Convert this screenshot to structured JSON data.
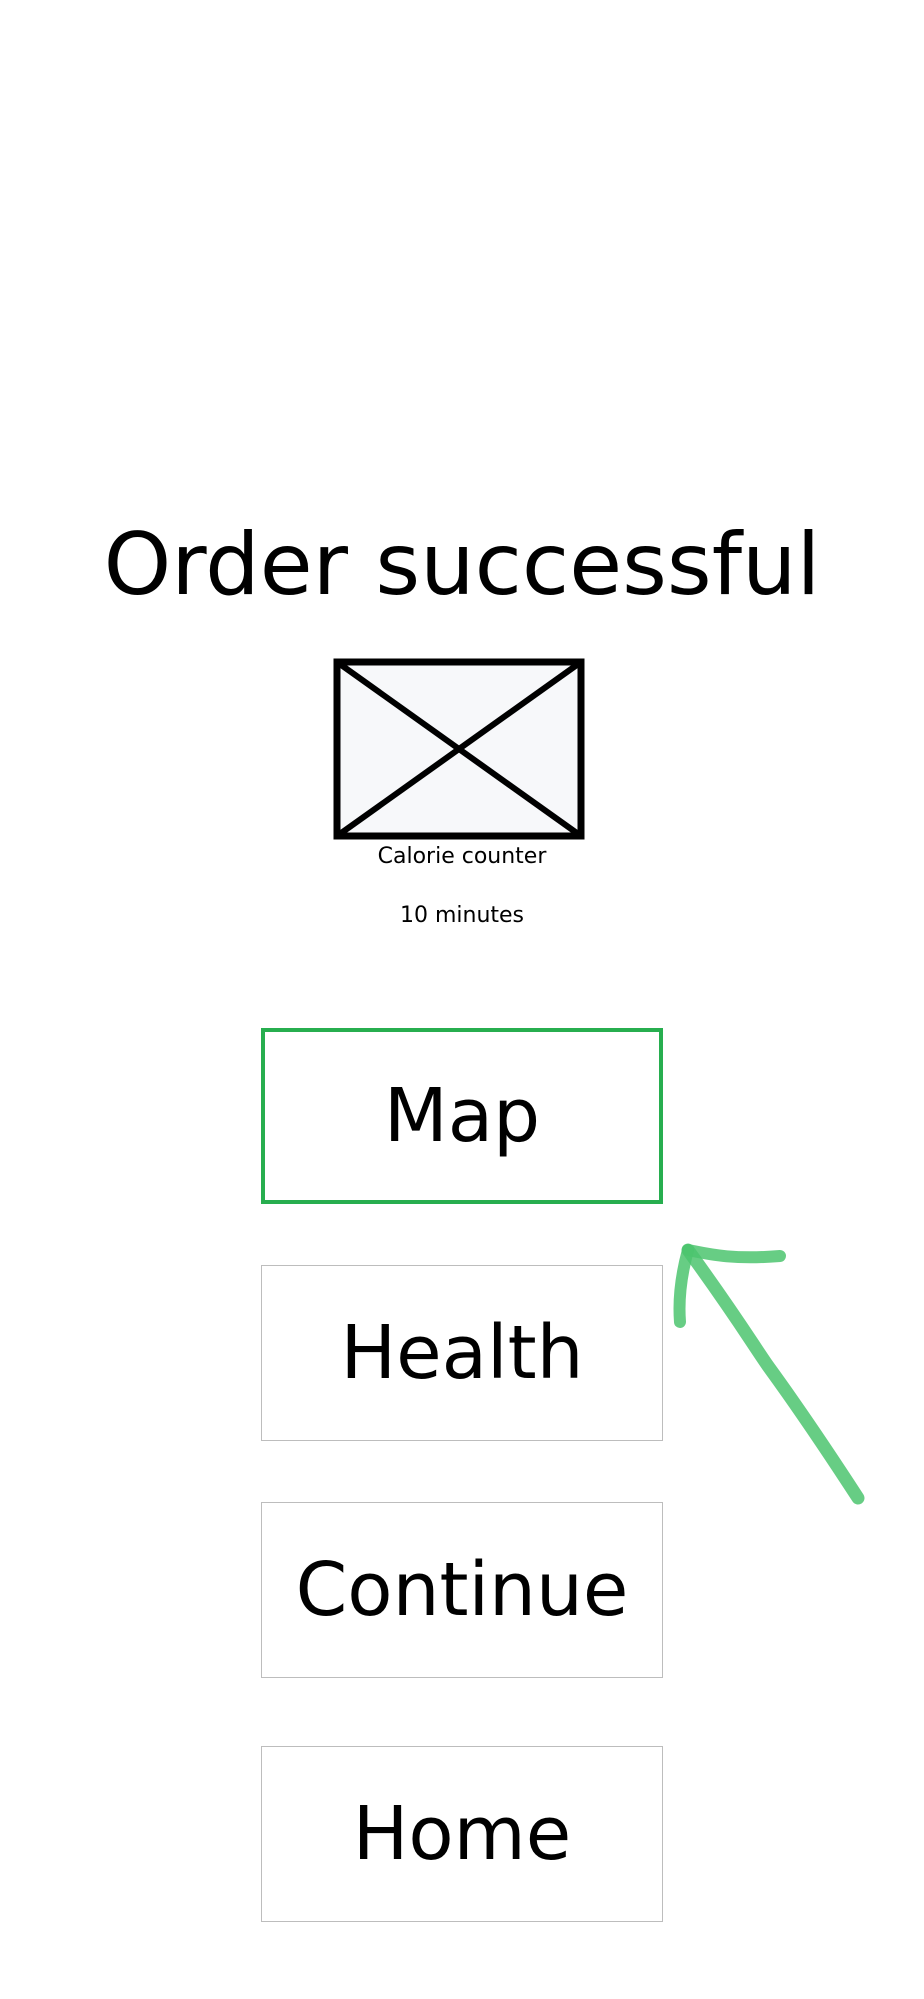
{
  "page": {
    "title": "Order successful"
  },
  "product": {
    "image_icon": "image-placeholder-icon",
    "name": "Calorie counter",
    "eta": "10 minutes"
  },
  "menu": {
    "buttons": [
      {
        "label": "Map",
        "selected": true
      },
      {
        "label": "Health",
        "selected": false
      },
      {
        "label": "Continue",
        "selected": false
      },
      {
        "label": "Home",
        "selected": false
      }
    ]
  },
  "colors": {
    "accent": "#27ae4f",
    "annotation": "#4cc46e",
    "button_border": "#bdbdbd",
    "placeholder_fill": "#f7f8fa"
  }
}
